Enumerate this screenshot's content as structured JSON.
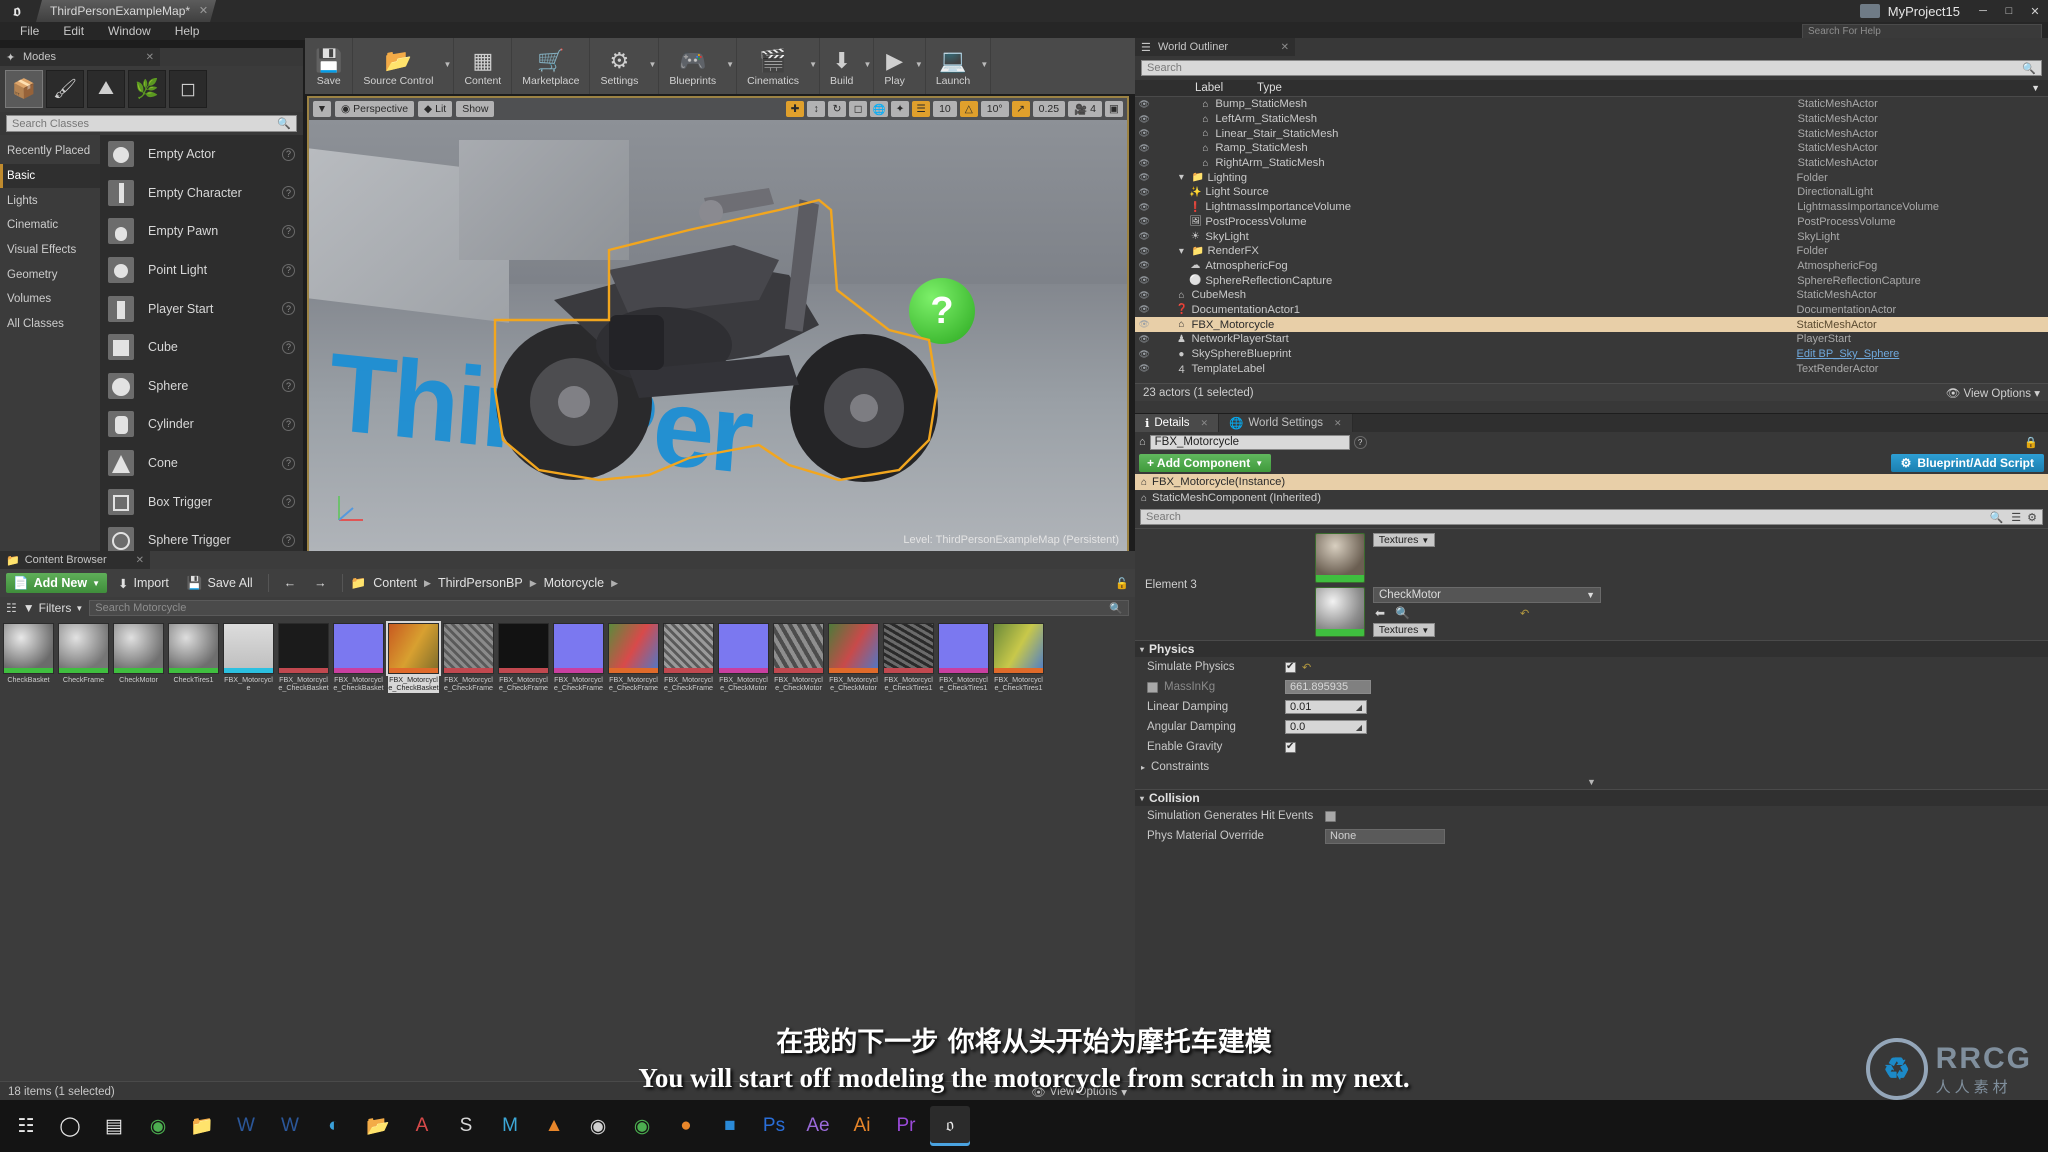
{
  "titlebar": {
    "logo": "ue-logo",
    "map_tab": "ThirdPersonExampleMap*",
    "project": "MyProject15",
    "min": "─",
    "max": "□",
    "close": "✕"
  },
  "menubar": {
    "items": [
      "File",
      "Edit",
      "Window",
      "Help"
    ],
    "help_search_placeholder": "Search For Help"
  },
  "modes": {
    "tab_title": "Modes",
    "mode_icons": [
      "place-mode-icon",
      "paint-mode-icon",
      "landscape-mode-icon",
      "foliage-mode-icon",
      "geometry-edit-mode-icon"
    ],
    "search_placeholder": "Search Classes",
    "categories": [
      "Recently Placed",
      "Basic",
      "Lights",
      "Cinematic",
      "Visual Effects",
      "Geometry",
      "Volumes",
      "All Classes"
    ],
    "selected_category": "Basic",
    "items": [
      {
        "label": "Empty Actor"
      },
      {
        "label": "Empty Character"
      },
      {
        "label": "Empty Pawn"
      },
      {
        "label": "Point Light"
      },
      {
        "label": "Player Start"
      },
      {
        "label": "Cube"
      },
      {
        "label": "Sphere"
      },
      {
        "label": "Cylinder"
      },
      {
        "label": "Cone"
      },
      {
        "label": "Box Trigger"
      },
      {
        "label": "Sphere Trigger"
      }
    ]
  },
  "toolbar": {
    "items": [
      {
        "label": "Save",
        "icon": "save-icon",
        "caret": false
      },
      {
        "label": "Source Control",
        "icon": "source-control-icon",
        "caret": true
      },
      {
        "label": "Content",
        "icon": "content-icon",
        "caret": false
      },
      {
        "label": "Marketplace",
        "icon": "marketplace-icon",
        "caret": false
      },
      {
        "label": "Settings",
        "icon": "settings-icon",
        "caret": true
      },
      {
        "label": "Blueprints",
        "icon": "blueprints-icon",
        "caret": true
      },
      {
        "label": "Cinematics",
        "icon": "cinematics-icon",
        "caret": true
      },
      {
        "label": "Build",
        "icon": "build-icon",
        "caret": true
      },
      {
        "label": "Play",
        "icon": "play-icon",
        "caret": true
      },
      {
        "label": "Launch",
        "icon": "launch-icon",
        "caret": true
      }
    ]
  },
  "viewport": {
    "perspective": "Perspective",
    "lit": "Lit",
    "show": "Show",
    "grid_snap_value": "10",
    "rotation_snap_value": "10°",
    "scale_snap_value": "0.25",
    "camera_speed_value": "4",
    "level_label": "Level:",
    "level_name": "ThirdPersonExampleMap (Persistent)",
    "scene_text": "ThirdPer",
    "question_mark": "?"
  },
  "outliner": {
    "tab_title": "World Outliner",
    "search_placeholder": "Search",
    "col_label": "Label",
    "col_type": "Type",
    "rows": [
      {
        "label": "Bump_StaticMesh",
        "type": "StaticMeshActor",
        "indent": 2,
        "icon": "mesh-icon"
      },
      {
        "label": "LeftArm_StaticMesh",
        "type": "StaticMeshActor",
        "indent": 2,
        "icon": "mesh-icon"
      },
      {
        "label": "Linear_Stair_StaticMesh",
        "type": "StaticMeshActor",
        "indent": 2,
        "icon": "mesh-icon"
      },
      {
        "label": "Ramp_StaticMesh",
        "type": "StaticMeshActor",
        "indent": 2,
        "icon": "mesh-icon"
      },
      {
        "label": "RightArm_StaticMesh",
        "type": "StaticMeshActor",
        "indent": 2,
        "icon": "mesh-icon"
      },
      {
        "label": "Lighting",
        "type": "Folder",
        "indent": 1,
        "icon": "folder-icon"
      },
      {
        "label": "Light Source",
        "type": "DirectionalLight",
        "indent": 2,
        "icon": "light-icon"
      },
      {
        "label": "LightmassImportanceVolume",
        "type": "LightmassImportanceVolume",
        "indent": 2,
        "icon": "volume-icon"
      },
      {
        "label": "PostProcessVolume",
        "type": "PostProcessVolume",
        "indent": 2,
        "icon": "postprocess-icon"
      },
      {
        "label": "SkyLight",
        "type": "SkyLight",
        "indent": 2,
        "icon": "skylight-icon"
      },
      {
        "label": "RenderFX",
        "type": "Folder",
        "indent": 1,
        "icon": "folder-icon"
      },
      {
        "label": "AtmosphericFog",
        "type": "AtmosphericFog",
        "indent": 2,
        "icon": "fog-icon"
      },
      {
        "label": "SphereReflectionCapture",
        "type": "SphereReflectionCapture",
        "indent": 2,
        "icon": "reflection-icon"
      },
      {
        "label": "CubeMesh",
        "type": "StaticMeshActor",
        "indent": 1,
        "icon": "mesh-icon"
      },
      {
        "label": "DocumentationActor1",
        "type": "DocumentationActor",
        "indent": 1,
        "icon": "doc-icon"
      },
      {
        "label": "FBX_Motorcycle",
        "type": "StaticMeshActor",
        "indent": 1,
        "icon": "mesh-icon",
        "selected": true
      },
      {
        "label": "NetworkPlayerStart",
        "type": "PlayerStart",
        "indent": 1,
        "icon": "playerstart-icon"
      },
      {
        "label": "SkySphereBlueprint",
        "type": "Edit BP_Sky_Sphere",
        "indent": 1,
        "icon": "sphere-icon",
        "type_link": true
      },
      {
        "label": "TemplateLabel",
        "type": "TextRenderActor",
        "indent": 1,
        "icon": "text-icon"
      }
    ],
    "footer": "23 actors (1 selected)",
    "view_options": "View Options"
  },
  "details": {
    "tabs": [
      {
        "label": "Details",
        "active": true
      },
      {
        "label": "World Settings",
        "active": false
      }
    ],
    "actor_name": "FBX_Motorcycle",
    "add_component": "+ Add Component",
    "blueprint_script": "Blueprint/Add Script",
    "components": [
      {
        "label": "FBX_Motorcycle(Instance)",
        "selected": true
      },
      {
        "label": "StaticMeshComponent (Inherited)",
        "selected": false
      }
    ],
    "search_placeholder": "Search",
    "materials": {
      "element_label": "Element 3",
      "textures_label": "Textures",
      "material_name": "CheckMotor"
    },
    "physics": {
      "header": "Physics",
      "props": [
        {
          "label": "Simulate Physics",
          "type": "checkbox",
          "checked": true,
          "undo": true
        },
        {
          "label": "MassInKg",
          "type": "checkbox_field",
          "checked": false,
          "value": "661.895935",
          "disabled": true
        },
        {
          "label": "Linear Damping",
          "type": "number",
          "value": "0.01"
        },
        {
          "label": "Angular Damping",
          "type": "number",
          "value": "0.0"
        },
        {
          "label": "Enable Gravity",
          "type": "checkbox",
          "checked": true
        }
      ],
      "constraints": "Constraints"
    },
    "collision": {
      "header": "Collision",
      "props": [
        {
          "label": "Simulation Generates Hit Events",
          "type": "checkbox",
          "checked": false
        },
        {
          "label": "Phys Material Override",
          "type": "combo",
          "value": "None"
        }
      ]
    }
  },
  "content_browser": {
    "tab_title": "Content Browser",
    "add_new": "Add New",
    "import": "Import",
    "save_all": "Save All",
    "breadcrumb": [
      "Content",
      "ThirdPersonBP",
      "Motorcycle"
    ],
    "filters": "Filters",
    "search_placeholder": "Search Motorcycle",
    "assets": [
      {
        "name": "CheckBasket",
        "kind": "material",
        "color": "#6b6b6b",
        "bar": "#3fbf3f"
      },
      {
        "name": "CheckFrame",
        "kind": "material",
        "color": "#767676",
        "bar": "#3fbf3f"
      },
      {
        "name": "CheckMotor",
        "kind": "material",
        "color": "#717171",
        "bar": "#3fbf3f"
      },
      {
        "name": "CheckTires1",
        "kind": "material",
        "color": "#6e6e6e",
        "bar": "#3fbf3f"
      },
      {
        "name": "FBX_Motorcycle",
        "kind": "mesh",
        "color": "#d5d5d5",
        "bar": "#2bc0e0"
      },
      {
        "name": "FBX_Motorcycle_CheckBasket",
        "kind": "texture",
        "color": "#1b1b1b",
        "bar": "#c1484f"
      },
      {
        "name": "FBX_Motorcycle_CheckBasket",
        "kind": "texture",
        "color": "#7b78f0",
        "bar": "#c93fa0"
      },
      {
        "name": "FBX_Motorcycle_CheckBasket",
        "kind": "texture",
        "color": "#7c6b2a",
        "bar": "#e06a2a",
        "selected": true
      },
      {
        "name": "FBX_Motorcycle_CheckFrame",
        "kind": "texture",
        "color": "#8a8a8a",
        "bar": "#c1484f"
      },
      {
        "name": "FBX_Motorcycle_CheckFrame",
        "kind": "texture",
        "color": "#121212",
        "bar": "#c1484f"
      },
      {
        "name": "FBX_Motorcycle_CheckFrame",
        "kind": "texture",
        "color": "#7b78f0",
        "bar": "#c93fa0"
      },
      {
        "name": "FBX_Motorcycle_CheckFrame",
        "kind": "texture",
        "color": "#5b8a3c",
        "bar": "#e06a2a"
      },
      {
        "name": "FBX_Motorcycle_CheckFrame",
        "kind": "texture",
        "color": "#8a8a8a",
        "bar": "#c1484f"
      },
      {
        "name": "FBX_Motorcycle_CheckMotor",
        "kind": "texture",
        "color": "#7b78f0",
        "bar": "#c93fa0"
      },
      {
        "name": "FBX_Motorcycle_CheckMotor",
        "kind": "texture",
        "color": "#6f6f6f",
        "bar": "#c1484f"
      },
      {
        "name": "FBX_Motorcycle_CheckMotor",
        "kind": "texture",
        "color": "#4d7a3a",
        "bar": "#e06a2a"
      },
      {
        "name": "FBX_Motorcycle_CheckTires1",
        "kind": "texture",
        "color": "#4a4a4a",
        "bar": "#c1484f"
      },
      {
        "name": "FBX_Motorcycle_CheckTires1",
        "kind": "texture",
        "color": "#7b78f0",
        "bar": "#c93fa0"
      },
      {
        "name": "FBX_Motorcycle_CheckTires1",
        "kind": "texture",
        "color": "#6a8a3a",
        "bar": "#e06a2a"
      }
    ],
    "footer": "18 items (1 selected)",
    "view_options": "View Options"
  },
  "subtitles": {
    "chinese": "在我的下一步 你将从头开始为摩托车建模",
    "english": "You will start off modeling the motorcycle from scratch in my next."
  },
  "watermark": {
    "logo": "rrcg-logo",
    "text": "RRCG",
    "subtext": "人人素材"
  },
  "taskbar": {
    "items": [
      "start-icon",
      "search-icon",
      "taskview-icon",
      "chrome-icon",
      "explorer-icon",
      "word-icon",
      "word2-icon",
      "edge-icon",
      "folder2-icon",
      "acrobat-icon",
      "substance-icon",
      "maya-icon",
      "vlc-icon",
      "ue4-icon",
      "chrome2-icon",
      "blender-icon",
      "3dsmax-icon",
      "photoshop-icon",
      "aftereffects-icon",
      "illustrator-icon",
      "premiere-icon",
      "unreal-taskbar-icon"
    ]
  },
  "colors": {
    "accent_orange": "#e0a02c",
    "selection": "#e8cfa8",
    "green_button": "#4f9f4b",
    "blue_button": "#1f8fc4"
  }
}
